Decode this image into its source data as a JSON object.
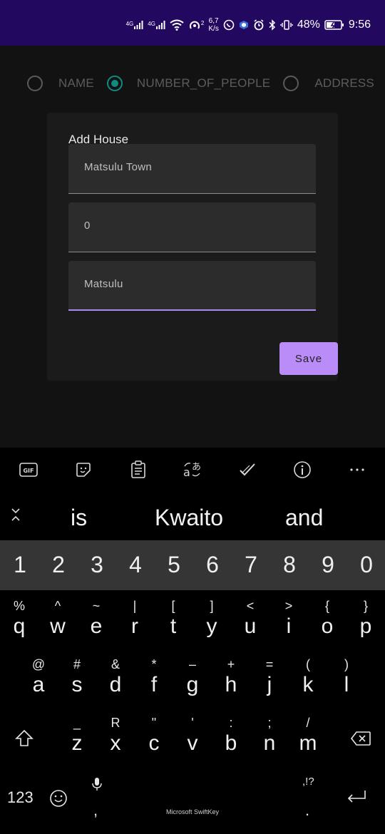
{
  "status_bar": {
    "net1": "4G",
    "net2": "4G",
    "speed_top": "6,7",
    "speed_bottom": "K/s",
    "hotspot_sup": "2",
    "battery": "48%",
    "time": "9:56"
  },
  "radio_group": {
    "options": [
      {
        "label": "NAME",
        "checked": false
      },
      {
        "label": "NUMBER_OF_PEOPLE",
        "checked": true
      },
      {
        "label": "ADDRESS",
        "checked": false
      }
    ]
  },
  "form": {
    "title": "Add House",
    "fields": [
      {
        "value": "Matsulu Town"
      },
      {
        "value": "0"
      },
      {
        "value": "Matsulu"
      }
    ],
    "save_label": "Save"
  },
  "keyboard": {
    "suggestions": [
      "is",
      "Kwaito",
      "and"
    ],
    "number_row": [
      "1",
      "2",
      "3",
      "4",
      "5",
      "6",
      "7",
      "8",
      "9",
      "0"
    ],
    "row1": [
      {
        "sec": "%",
        "pri": "q"
      },
      {
        "sec": "^",
        "pri": "w"
      },
      {
        "sec": "~",
        "pri": "e"
      },
      {
        "sec": "|",
        "pri": "r"
      },
      {
        "sec": "[",
        "pri": "t"
      },
      {
        "sec": "]",
        "pri": "y"
      },
      {
        "sec": "<",
        "pri": "u"
      },
      {
        "sec": ">",
        "pri": "i"
      },
      {
        "sec": "{",
        "pri": "o"
      },
      {
        "sec": "}",
        "pri": "p"
      }
    ],
    "row2": [
      {
        "sec": "@",
        "pri": "a"
      },
      {
        "sec": "#",
        "pri": "s"
      },
      {
        "sec": "&",
        "pri": "d"
      },
      {
        "sec": "*",
        "pri": "f"
      },
      {
        "sec": "–",
        "pri": "g"
      },
      {
        "sec": "+",
        "pri": "h"
      },
      {
        "sec": "=",
        "pri": "j"
      },
      {
        "sec": "(",
        "pri": "k"
      },
      {
        "sec": ")",
        "pri": "l"
      }
    ],
    "row3": [
      {
        "sec": "_",
        "pri": "z"
      },
      {
        "sec": "R",
        "pri": "x"
      },
      {
        "sec": "\"",
        "pri": "c"
      },
      {
        "sec": "'",
        "pri": "v"
      },
      {
        "sec": ":",
        "pri": "b"
      },
      {
        "sec": ";",
        "pri": "n"
      },
      {
        "sec": "/",
        "pri": "m"
      }
    ],
    "numbers_key": "123",
    "comma_key": ",",
    "period_key": ".",
    "punct_hint": ",!?",
    "brand": "Microsoft SwiftKey"
  },
  "colors": {
    "status_bar": "#22085f",
    "accent_teal": "#0f8b80",
    "accent_purple": "#b98cf7"
  }
}
